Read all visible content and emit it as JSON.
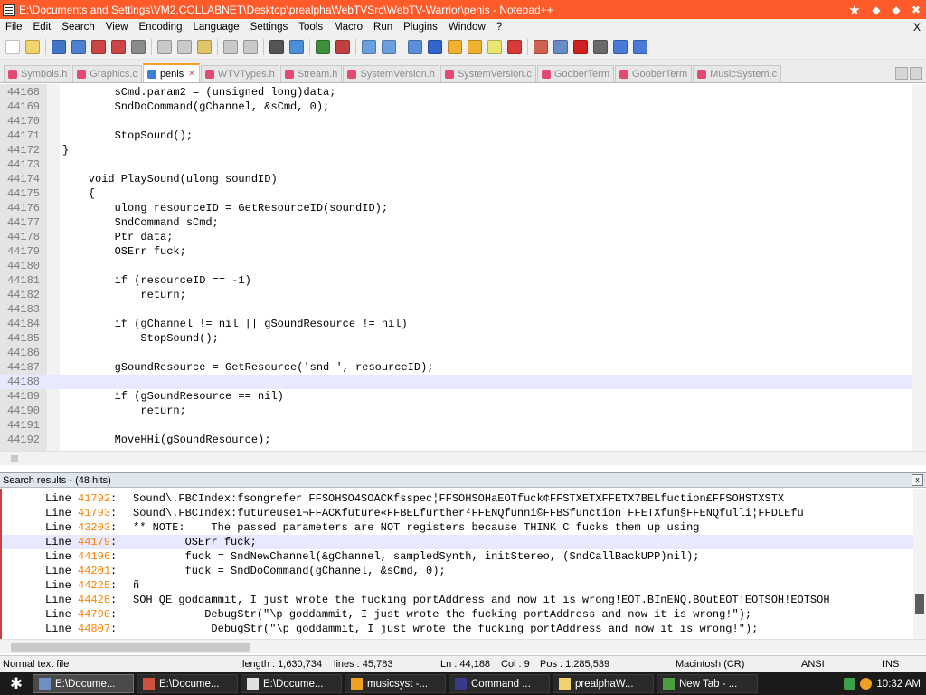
{
  "window": {
    "title": "E:\\Documents and Settings\\VM2.COLLABNET\\Desktop\\prealphaWebTVSrc\\WebTV-Warrior\\penis - Notepad++",
    "controls": [
      "★",
      "◆",
      "◆",
      "✖"
    ]
  },
  "menu": {
    "items": [
      "File",
      "Edit",
      "Search",
      "View",
      "Encoding",
      "Language",
      "Settings",
      "Tools",
      "Macro",
      "Run",
      "Plugins",
      "Window",
      "?"
    ],
    "close": "X"
  },
  "toolbar": {
    "icons": [
      "new-file-icon",
      "open-file-icon",
      "save-icon",
      "save-all-icon",
      "close-icon",
      "close-all-icon",
      "print-icon",
      "cut-icon",
      "copy-icon",
      "paste-icon",
      "undo-icon",
      "redo-icon",
      "find-icon",
      "replace-icon",
      "zoom-in-icon",
      "zoom-out-icon",
      "sync-vertical-icon",
      "sync-horizontal-icon",
      "word-wrap-icon",
      "all-chars-icon",
      "indent-guide-icon",
      "language-icon",
      "user-defined-icon",
      "doc-map-icon",
      "monitor-icon",
      "record-macro-icon",
      "stop-macro-icon",
      "play-macro-icon",
      "run-multiple-icon",
      "save-macro-icon"
    ],
    "colors": [
      "#ffffff",
      "#f3d36b",
      "#3f74c8",
      "#4f7fd0",
      "#cc4444",
      "#cc4444",
      "#8a8a8a",
      "#c9c9c9",
      "#c9c9c9",
      "#e2c46a",
      "#c9c9c9",
      "#c9c9c9",
      "#555555",
      "#4a8fd8",
      "#3d8f3d",
      "#c04040",
      "#6aa0e0",
      "#6aa0e0",
      "#5b8fd8",
      "#3366cc",
      "#f0b030",
      "#f0b030",
      "#e8e870",
      "#d83a3a",
      "#d06050",
      "#6a8ac8",
      "#d02020",
      "#6a6a6a",
      "#4a7ad8",
      "#4a7ad8"
    ]
  },
  "tabs": [
    {
      "label": "Symbols.h",
      "active": false
    },
    {
      "label": "Graphics.c",
      "active": false
    },
    {
      "label": "penis",
      "active": true
    },
    {
      "label": "WTVTypes.h",
      "active": false
    },
    {
      "label": "Stream.h",
      "active": false
    },
    {
      "label": "SystemVersion.h",
      "active": false
    },
    {
      "label": "SystemVersion.c",
      "active": false
    },
    {
      "label": "GooberTerm",
      "active": false
    },
    {
      "label": "GooberTerm",
      "active": false
    },
    {
      "label": "MusicSystem.c",
      "active": false
    }
  ],
  "editor": {
    "current_line": "44188",
    "lines": [
      {
        "n": "44168",
        "t": "        sCmd.param2 = (unsigned long)data;"
      },
      {
        "n": "44169",
        "t": "        SndDoCommand(gChannel, &sCmd, 0);"
      },
      {
        "n": "44170",
        "t": ""
      },
      {
        "n": "44171",
        "t": "        StopSound();"
      },
      {
        "n": "44172",
        "t": "}"
      },
      {
        "n": "44173",
        "t": ""
      },
      {
        "n": "44174",
        "t": "    void PlaySound(ulong soundID)"
      },
      {
        "n": "44175",
        "t": "    {"
      },
      {
        "n": "44176",
        "t": "        ulong resourceID = GetResourceID(soundID);"
      },
      {
        "n": "44177",
        "t": "        SndCommand sCmd;"
      },
      {
        "n": "44178",
        "t": "        Ptr data;"
      },
      {
        "n": "44179",
        "t": "        OSErr fuck;"
      },
      {
        "n": "44180",
        "t": ""
      },
      {
        "n": "44181",
        "t": "        if (resourceID == -1)"
      },
      {
        "n": "44182",
        "t": "            return;"
      },
      {
        "n": "44183",
        "t": ""
      },
      {
        "n": "44184",
        "t": "        if (gChannel != nil || gSoundResource != nil)"
      },
      {
        "n": "44185",
        "t": "            StopSound();"
      },
      {
        "n": "44186",
        "t": ""
      },
      {
        "n": "44187",
        "t": "        gSoundResource = GetResource('snd ', resourceID);"
      },
      {
        "n": "44188",
        "t": ""
      },
      {
        "n": "44189",
        "t": "        if (gSoundResource == nil)"
      },
      {
        "n": "44190",
        "t": "            return;"
      },
      {
        "n": "44191",
        "t": ""
      },
      {
        "n": "44192",
        "t": "        MoveHHi(gSoundResource);"
      }
    ]
  },
  "search": {
    "header": "Search results - (48 hits)",
    "close": "x",
    "current_line": "44179",
    "results": [
      {
        "label": "Line",
        "num": "41792",
        "text": "Sound\\.FBCIndex:fsongrefer FFSOHSO4SOACKfsspec¦FFSOHSOHaEOTfuck¢FFSTXETXFFETX7BELfuction£FFSOHSTXSTX"
      },
      {
        "label": "Line",
        "num": "41793",
        "text": "Sound\\.FBCIndex:futureuse1¬FFACKfuture«FFBELfurther²FFENQfunni©FFBSfunction¨FFETXfun§FFENQfulli¦FFDLEfu"
      },
      {
        "label": "Line",
        "num": "43203",
        "text": "** NOTE:    The passed parameters are NOT registers because THINK C fucks them up using"
      },
      {
        "label": "Line",
        "num": "44179",
        "text": "        OSErr fuck;"
      },
      {
        "label": "Line",
        "num": "44196",
        "text": "        fuck = SndNewChannel(&gChannel, sampledSynth, initStereo, (SndCallBackUPP)nil);"
      },
      {
        "label": "Line",
        "num": "44201",
        "text": "        fuck = SndDoCommand(gChannel, &sCmd, 0);"
      },
      {
        "label": "Line",
        "num": "44225",
        "text": "ñ"
      },
      {
        "label": "Line",
        "num": "44428",
        "text": "SOH QE goddammit, I just wrote the fucking portAddress and now it is wrong!EOT.BInENQ.BOutEOT!EOTSOH!EOTSOH"
      },
      {
        "label": "Line",
        "num": "44790",
        "text": "           DebugStr(\"\\p goddammit, I just wrote the fucking portAddress and now it is wrong!\");"
      },
      {
        "label": "Line",
        "num": "44807",
        "text": "            DebugStr(\"\\p goddammit, I just wrote the fucking portAddress and now it is wrong!\");"
      }
    ]
  },
  "status": {
    "file_type": "Normal text file",
    "length": "length : 1,630,734",
    "lines": "lines : 45,783",
    "ln": "Ln : 44,188",
    "col": "Col : 9",
    "pos": "Pos : 1,285,539",
    "eol": "Macintosh (CR)",
    "encoding": "ANSI",
    "mode": "INS"
  },
  "taskbar": {
    "start_glyph": "✱",
    "tasks": [
      {
        "label": "E:\\Docume...",
        "icon_color": "#6f8fc0",
        "active": true
      },
      {
        "label": "E:\\Docume...",
        "icon_color": "#d05040",
        "active": false
      },
      {
        "label": "E:\\Docume...",
        "icon_color": "#e0e0e0",
        "active": false
      },
      {
        "label": "musicsyst -...",
        "icon_color": "#f0a020",
        "active": false
      },
      {
        "label": "Command ...",
        "icon_color": "#3a3a8a",
        "active": false
      },
      {
        "label": "prealphaW...",
        "icon_color": "#f0d070",
        "active": false
      },
      {
        "label": "New Tab - ...",
        "icon_color": "#4aa040",
        "active": false
      }
    ],
    "clock": "10:32 AM"
  }
}
